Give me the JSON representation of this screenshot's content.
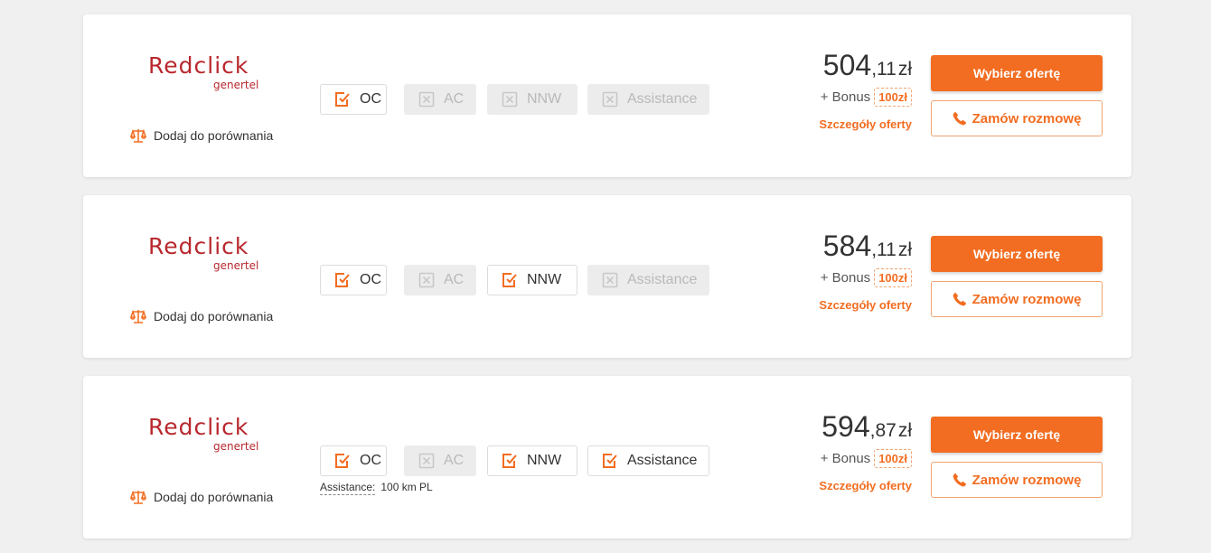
{
  "colors": {
    "accent": "#f26d21",
    "brand": "#b8282e",
    "disabled": "#b9b9b9"
  },
  "offers": [
    {
      "brand_name": "Redclick",
      "brand_sub": "genertel",
      "compare_label": "Dodaj do porównania",
      "coverages": [
        {
          "label": "OC",
          "included": true
        },
        {
          "label": "AC",
          "included": false
        },
        {
          "label": "NNW",
          "included": false
        },
        {
          "label": "Assistance",
          "included": false
        }
      ],
      "note": null,
      "price_main": "504",
      "price_decimal": ",11",
      "currency": "zł",
      "bonus_label": "+ Bonus",
      "bonus_value": "100zł",
      "details_label": "Szczegóły oferty",
      "select_label": "Wybierz ofertę",
      "call_label": "Zamów rozmowę"
    },
    {
      "brand_name": "Redclick",
      "brand_sub": "genertel",
      "compare_label": "Dodaj do porównania",
      "coverages": [
        {
          "label": "OC",
          "included": true
        },
        {
          "label": "AC",
          "included": false
        },
        {
          "label": "NNW",
          "included": true
        },
        {
          "label": "Assistance",
          "included": false
        }
      ],
      "note": null,
      "price_main": "584",
      "price_decimal": ",11",
      "currency": "zł",
      "bonus_label": "+ Bonus",
      "bonus_value": "100zł",
      "details_label": "Szczegóły oferty",
      "select_label": "Wybierz ofertę",
      "call_label": "Zamów rozmowę"
    },
    {
      "brand_name": "Redclick",
      "brand_sub": "genertel",
      "compare_label": "Dodaj do porównania",
      "coverages": [
        {
          "label": "OC",
          "included": true
        },
        {
          "label": "AC",
          "included": false
        },
        {
          "label": "NNW",
          "included": true
        },
        {
          "label": "Assistance",
          "included": true
        }
      ],
      "note": {
        "key": "Assistance:",
        "value": "100 km PL"
      },
      "price_main": "594",
      "price_decimal": ",87",
      "currency": "zł",
      "bonus_label": "+ Bonus",
      "bonus_value": "100zł",
      "details_label": "Szczegóły oferty",
      "select_label": "Wybierz ofertę",
      "call_label": "Zamów rozmowę"
    }
  ]
}
